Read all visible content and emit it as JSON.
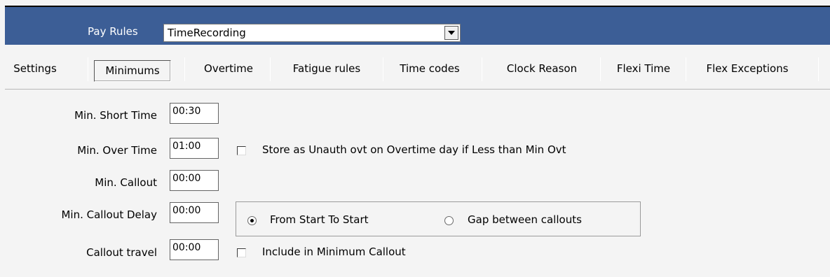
{
  "header": {
    "label": "Pay Rules",
    "select_value": "TimeRecording"
  },
  "tabs": [
    {
      "label": "Settings"
    },
    {
      "label": "Minimums"
    },
    {
      "label": "Overtime"
    },
    {
      "label": "Fatigue rules"
    },
    {
      "label": "Time codes"
    },
    {
      "label": "Clock Reason"
    },
    {
      "label": "Flexi Time"
    },
    {
      "label": "Flex Exceptions"
    }
  ],
  "active_tab": "Minimums",
  "form": {
    "min_short_time": {
      "label": "Min. Short Time",
      "value": "00:30"
    },
    "min_over_time": {
      "label": "Min. Over Time",
      "value": "01:00"
    },
    "min_callout": {
      "label": "Min. Callout",
      "value": "00:00"
    },
    "min_callout_delay": {
      "label": "Min. Callout Delay",
      "value": "00:00"
    },
    "callout_travel": {
      "label": "Callout travel",
      "value": "00:00"
    },
    "store_unauth_ovt": {
      "label": "Store as Unauth ovt on Overtime day if Less than Min Ovt",
      "checked": false
    },
    "callout_mode": {
      "options": [
        "From Start To Start",
        "Gap between callouts"
      ],
      "selected": "From Start To Start"
    },
    "include_min_callout": {
      "label": "Include in Minimum Callout",
      "checked": false
    }
  },
  "colors": {
    "header_bg": "#3c5e96",
    "window_bg": "#f4f4f4"
  }
}
